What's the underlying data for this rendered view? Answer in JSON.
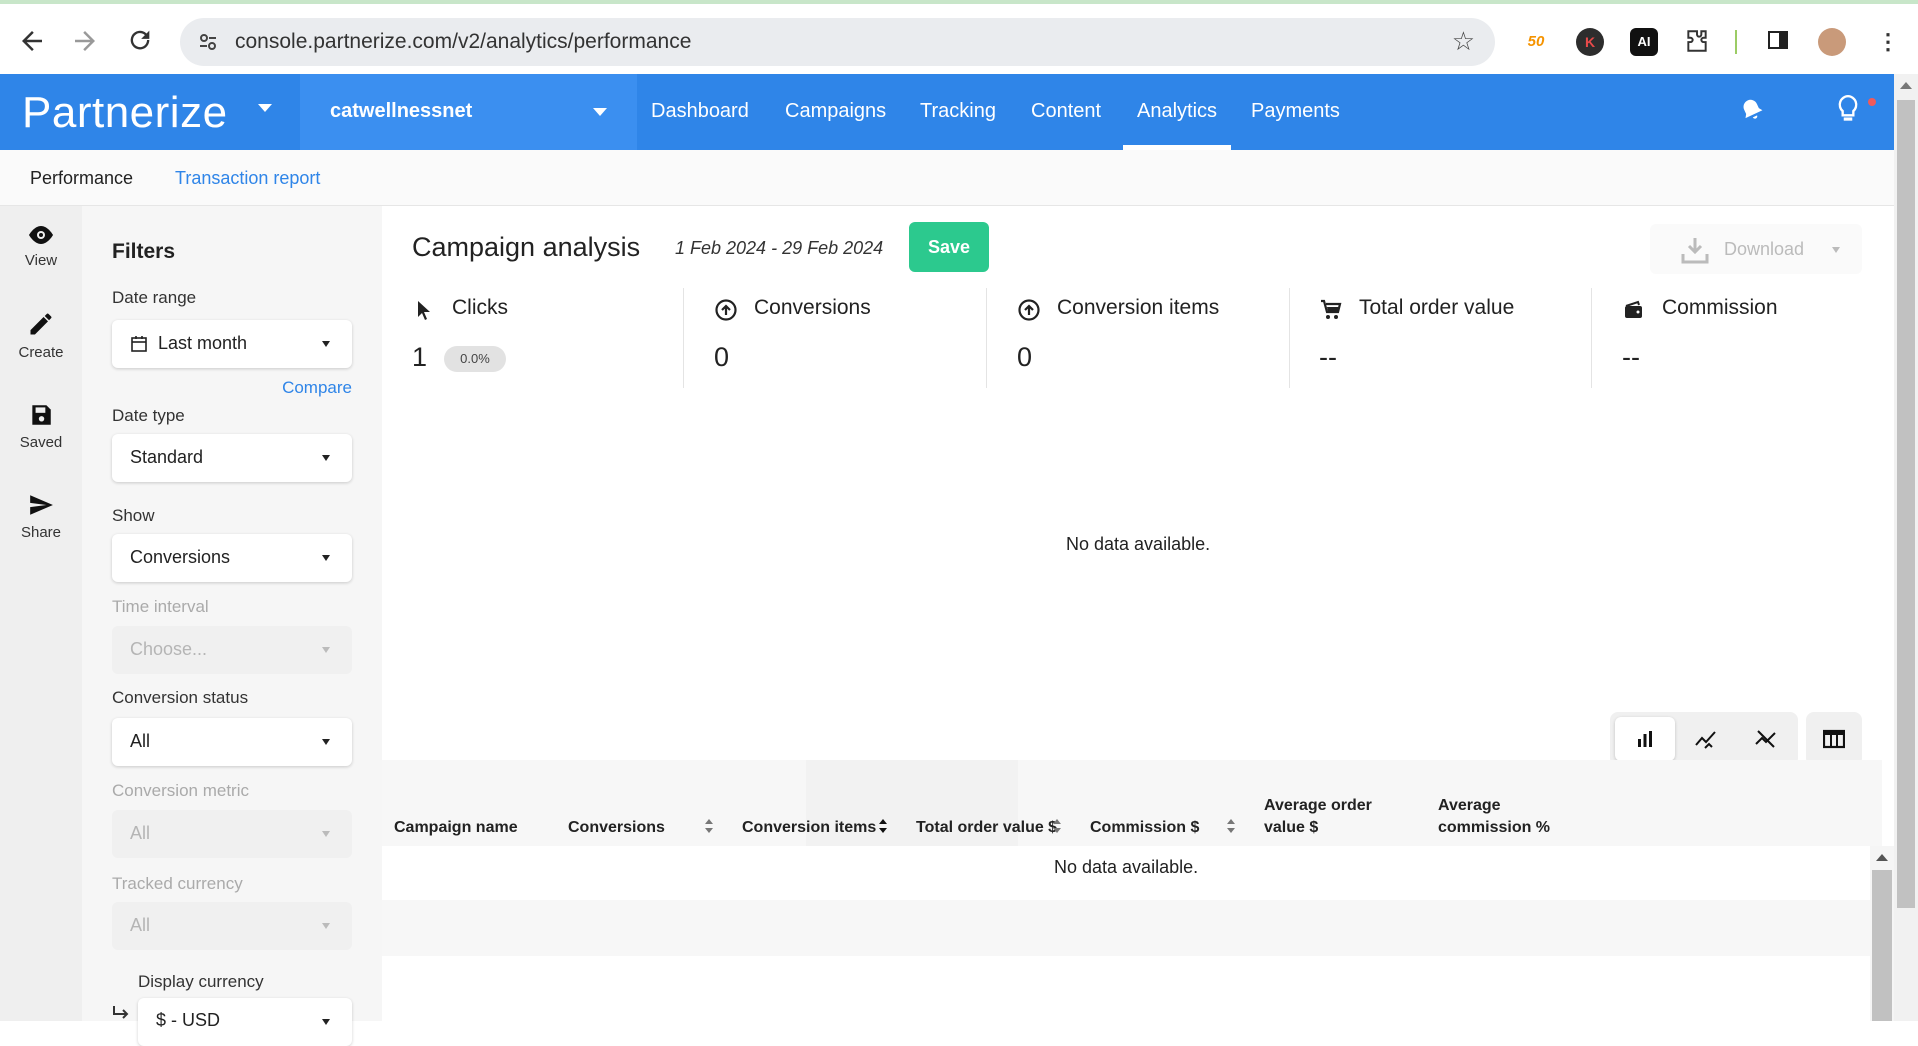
{
  "browser": {
    "url": "console.partnerize.com/v2/analytics/performance",
    "extension_badge": "50"
  },
  "topnav": {
    "logo": "Partnerize",
    "account": "catwellnessnet",
    "menu": [
      "Dashboard",
      "Campaigns",
      "Tracking",
      "Content",
      "Analytics",
      "Payments"
    ],
    "active_menu": "Analytics"
  },
  "subnav": {
    "tabs": [
      "Performance",
      "Transaction report"
    ],
    "active_tab": "Performance"
  },
  "leftrail": {
    "items": [
      "View",
      "Create",
      "Saved",
      "Share"
    ]
  },
  "filters": {
    "heading": "Filters",
    "date_range_label": "Date range",
    "date_range_value": "Last month",
    "compare_link": "Compare",
    "date_type_label": "Date type",
    "date_type_value": "Standard",
    "show_label": "Show",
    "show_value": "Conversions",
    "time_interval_label": "Time interval",
    "time_interval_value": "Choose...",
    "conversion_status_label": "Conversion status",
    "conversion_status_value": "All",
    "conversion_metric_label": "Conversion metric",
    "conversion_metric_value": "All",
    "tracked_currency_label": "Tracked currency",
    "tracked_currency_value": "All",
    "display_currency_label": "Display currency",
    "display_currency_value": "$ - USD"
  },
  "main": {
    "title": "Campaign analysis",
    "date_range": "1 Feb 2024 - 29 Feb 2024",
    "save_label": "Save",
    "download_label": "Download",
    "no_data": "No data available.",
    "metrics": [
      {
        "label": "Clicks",
        "value": "1",
        "badge": "0.0%",
        "icon": "cursor-icon"
      },
      {
        "label": "Conversions",
        "value": "0",
        "icon": "arrow-up-circle-icon"
      },
      {
        "label": "Conversion items",
        "value": "0",
        "icon": "arrow-up-circle-icon"
      },
      {
        "label": "Total order value",
        "value": "--",
        "icon": "cart-icon"
      },
      {
        "label": "Commission",
        "value": "--",
        "icon": "wallet-icon"
      }
    ],
    "table": {
      "columns": [
        "Campaign name",
        "Conversions",
        "Conversion items",
        "Total order value $",
        "Commission $",
        "Average order value $",
        "Average commission %"
      ],
      "no_data": "No data available."
    }
  },
  "colors": {
    "brand_blue": "#2f85e8",
    "save_green": "#2cc98e"
  }
}
